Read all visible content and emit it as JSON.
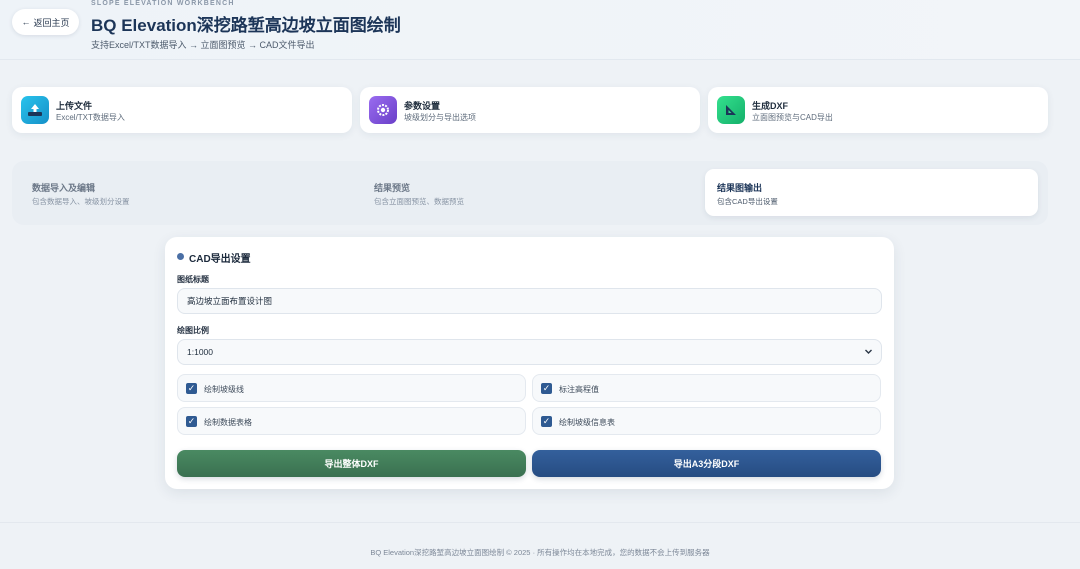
{
  "header": {
    "back_label": "返回主页",
    "back_arrow": "←",
    "eyebrow": "SLOPE ELEVATION WORKBENCH",
    "title": "BQ Elevation深挖路堑高边坡立面图绘制",
    "subtitle": "支持Excel/TXT数据导入 → 立面图预览 → CAD文件导出"
  },
  "steps": [
    {
      "title": "上传文件",
      "desc": "Excel/TXT数据导入",
      "icon": "upload-icon",
      "color": "#1aa8d8"
    },
    {
      "title": "参数设置",
      "desc": "坡级划分与导出选项",
      "icon": "gear-icon",
      "color": "#7a4fd8"
    },
    {
      "title": "生成DXF",
      "desc": "立面图预览与CAD导出",
      "icon": "triangle-ruler-icon",
      "color": "#1fc27a"
    }
  ],
  "tabs": [
    {
      "title": "数据导入及编辑",
      "desc": "包含数据导入、坡级划分设置"
    },
    {
      "title": "结果预览",
      "desc": "包含立面图预览、数据预览"
    },
    {
      "title": "结果图输出",
      "desc": "包含CAD导出设置"
    }
  ],
  "panel": {
    "title": "CAD导出设置",
    "drawing_title_label": "图纸标题",
    "drawing_title_value": "高边坡立面布置设计图",
    "scale_label": "绘图比例",
    "scale_value": "1:1000",
    "checkboxes": [
      {
        "label": "绘制坡级线",
        "checked": true
      },
      {
        "label": "标注高程值",
        "checked": true
      },
      {
        "label": "绘制数据表格",
        "checked": true
      },
      {
        "label": "绘制坡级信息表",
        "checked": true
      }
    ],
    "export_full_label": "导出整体DXF",
    "export_a3_label": "导出A3分段DXF"
  },
  "footer": {
    "text": "BQ Elevation深挖路堑高边坡立面图绘制 © 2025 · 所有操作均在本地完成，您的数据不会上传到服务器"
  },
  "colors": {
    "accent": "#2f5a92",
    "green_button": "#3a7050",
    "blue_button": "#264c82"
  }
}
